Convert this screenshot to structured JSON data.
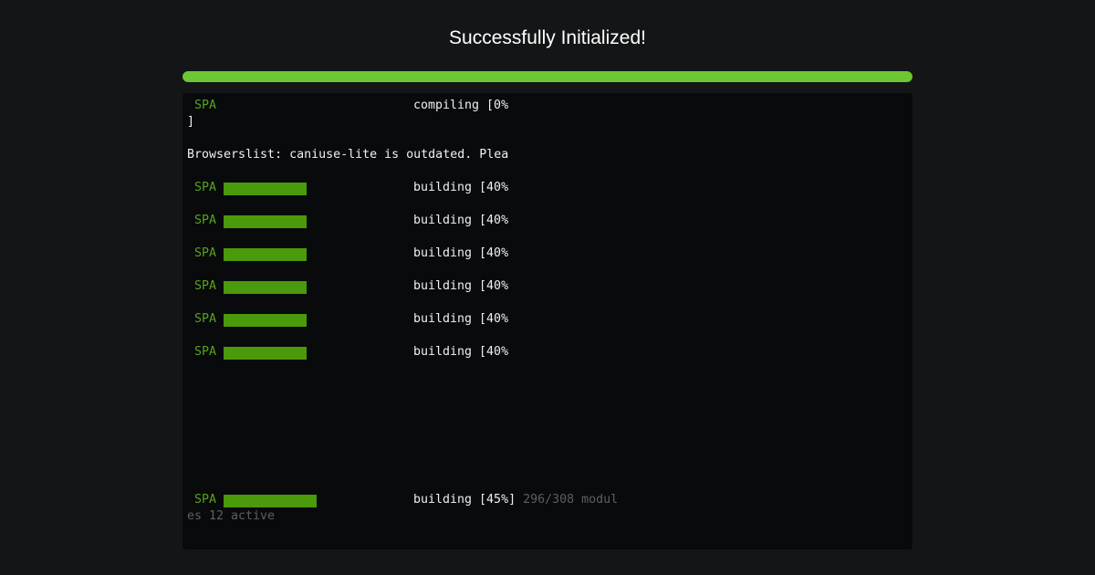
{
  "header": {
    "title": "Successfully Initialized!",
    "progress_percent": 100,
    "accent_color": "#6cc832"
  },
  "terminal": {
    "line1_name": "SPA",
    "line1_status": "compiling [0%",
    "line1_wrap": "]",
    "warning": "Browserslist: caniuse-lite is outdated. Plea",
    "build_rows": [
      {
        "name": "SPA",
        "status": "building [40%",
        "fill": 0.4
      },
      {
        "name": "SPA",
        "status": "building [40%",
        "fill": 0.4
      },
      {
        "name": "SPA",
        "status": "building [40%",
        "fill": 0.4
      },
      {
        "name": "SPA",
        "status": "building [40%",
        "fill": 0.4
      },
      {
        "name": "SPA",
        "status": "building [40%",
        "fill": 0.4
      },
      {
        "name": "SPA",
        "status": "building [40%",
        "fill": 0.4
      }
    ],
    "final": {
      "name": "SPA",
      "status": "building [45%]",
      "modules": "296/308 modul",
      "modules_wrap": "es 12 active",
      "fill": 0.45
    },
    "name_color": "#55a41e",
    "bar_color": "#4a9a0c"
  }
}
